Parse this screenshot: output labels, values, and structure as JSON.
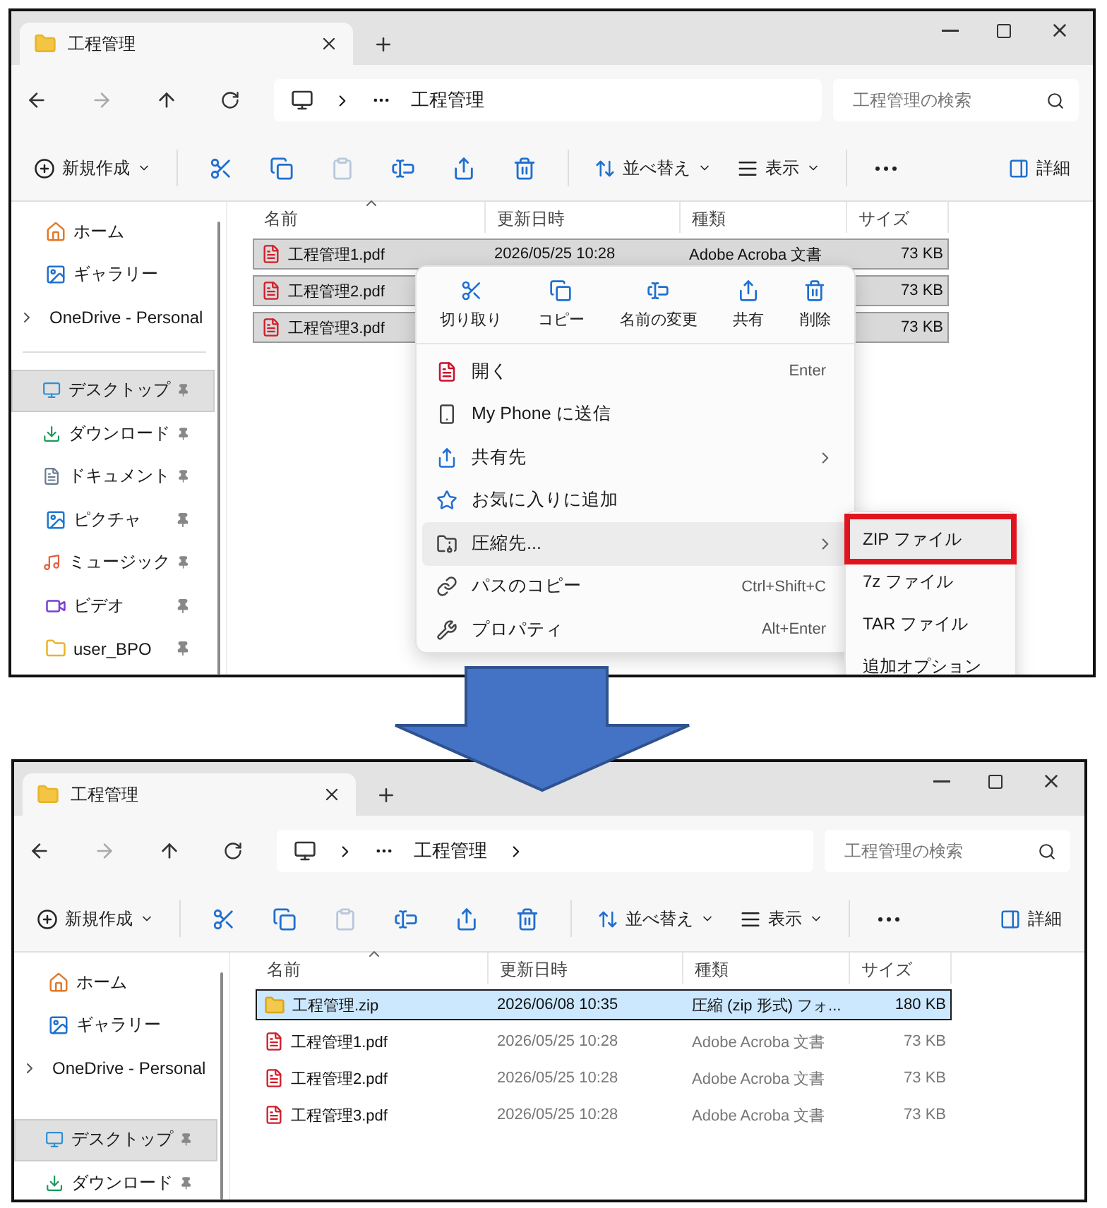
{
  "windows": [
    {
      "tab_title": "工程管理",
      "address": "工程管理",
      "address_chevron": false,
      "search_placeholder": "工程管理の検索",
      "toolbar": {
        "new": "新規作成",
        "icons": [
          {
            "kind": "cut",
            "disabled": false
          },
          {
            "kind": "copy",
            "disabled": false
          },
          {
            "kind": "paste",
            "disabled": true
          },
          {
            "kind": "rename",
            "disabled": false
          },
          {
            "kind": "share",
            "disabled": false
          },
          {
            "kind": "delete",
            "disabled": false
          }
        ],
        "sort": "並べ替え",
        "view": "表示",
        "details": "詳細"
      },
      "sidebar": [
        [
          {
            "kind": "home",
            "label": "ホーム",
            "pinned": false,
            "selected": false,
            "expandable": false
          },
          {
            "kind": "gallery",
            "label": "ギャラリー",
            "pinned": false,
            "selected": false,
            "expandable": false
          },
          {
            "kind": "file",
            "label": "OneDrive - Personal",
            "pinned": false,
            "selected": false,
            "expandable": true
          }
        ],
        [
          {
            "kind": "desktop",
            "label": "デスクトップ",
            "pinned": true,
            "selected": true,
            "expandable": false
          },
          {
            "kind": "download",
            "label": "ダウンロード",
            "pinned": true,
            "selected": false,
            "expandable": false
          },
          {
            "kind": "document",
            "label": "ドキュメント",
            "pinned": true,
            "selected": false,
            "expandable": false
          },
          {
            "kind": "picture",
            "label": "ピクチャ",
            "pinned": true,
            "selected": false,
            "expandable": false
          },
          {
            "kind": "music",
            "label": "ミュージック",
            "pinned": true,
            "selected": false,
            "expandable": false
          },
          {
            "kind": "video",
            "label": "ビデオ",
            "pinned": true,
            "selected": false,
            "expandable": false
          },
          {
            "kind": "folder",
            "label": "user_BPO",
            "pinned": true,
            "selected": false,
            "expandable": false
          }
        ]
      ],
      "list_focused": false,
      "columns": [
        "名前",
        "更新日時",
        "種類",
        "サイズ"
      ],
      "rows": [
        {
          "kind": "pdf",
          "name": "工程管理1.pdf",
          "date": "2026/05/25 10:28",
          "type": "Adobe Acroba 文書",
          "size": "73 KB",
          "selected": true
        },
        {
          "kind": "pdf",
          "name": "工程管理2.pdf",
          "size": "73 KB",
          "selected": true
        },
        {
          "kind": "pdf",
          "name": "工程管理3.pdf",
          "size": "73 KB",
          "selected": true
        }
      ],
      "context_menu": {
        "actions": [
          {
            "kind": "cut",
            "label": "切り取り"
          },
          {
            "kind": "copy",
            "label": "コピー"
          },
          {
            "kind": "rename",
            "label": "名前の変更"
          },
          {
            "kind": "share",
            "label": "共有"
          },
          {
            "kind": "delete",
            "label": "削除"
          }
        ],
        "items": [
          {
            "kind": "pdf",
            "label": "開く",
            "shortcut": "Enter",
            "submenu": false,
            "highlighted": false
          },
          {
            "kind": "phone",
            "label": "My Phone に送信",
            "submenu": false,
            "highlighted": false
          },
          {
            "kind": "share",
            "label": "共有先",
            "submenu": true,
            "highlighted": false
          },
          {
            "kind": "star",
            "label": "お気に入りに追加",
            "submenu": false,
            "highlighted": false
          },
          {
            "kind": "archive",
            "label": "圧縮先...",
            "submenu": true,
            "highlighted": true
          },
          {
            "kind": "path",
            "label": "パスのコピー",
            "shortcut": "Ctrl+Shift+C",
            "submenu": false,
            "highlighted": false
          },
          {
            "kind": "wrench",
            "label": "プロパティ",
            "shortcut": "Alt+Enter",
            "submenu": false,
            "highlighted": false
          }
        ],
        "submenu": [
          {
            "label": "ZIP ファイル",
            "highlighted": true,
            "emphasized": true
          },
          {
            "label": "7z ファイル",
            "highlighted": false,
            "emphasized": false
          },
          {
            "label": "TAR ファイル",
            "highlighted": false,
            "emphasized": false
          },
          {
            "label": "追加オプション",
            "highlighted": false,
            "emphasized": false
          }
        ]
      }
    },
    {
      "tab_title": "工程管理",
      "address": "工程管理",
      "address_chevron": true,
      "search_placeholder": "工程管理の検索",
      "toolbar": {
        "new": "新規作成",
        "icons": [
          {
            "kind": "cut",
            "disabled": false
          },
          {
            "kind": "copy",
            "disabled": false
          },
          {
            "kind": "paste",
            "disabled": true
          },
          {
            "kind": "rename",
            "disabled": false
          },
          {
            "kind": "share",
            "disabled": false
          },
          {
            "kind": "delete",
            "disabled": false
          }
        ],
        "sort": "並べ替え",
        "view": "表示",
        "details": "詳細"
      },
      "sidebar": [
        [
          {
            "kind": "home",
            "label": "ホーム",
            "pinned": false,
            "selected": false,
            "expandable": false
          },
          {
            "kind": "gallery",
            "label": "ギャラリー",
            "pinned": false,
            "selected": false,
            "expandable": false
          },
          {
            "kind": "file",
            "label": "OneDrive - Personal",
            "pinned": false,
            "selected": false,
            "expandable": true
          }
        ],
        [
          {
            "kind": "desktop",
            "label": "デスクトップ",
            "pinned": true,
            "selected": true,
            "expandable": false
          },
          {
            "kind": "download",
            "label": "ダウンロード",
            "pinned": true,
            "selected": false,
            "expandable": false
          }
        ]
      ],
      "list_focused": true,
      "columns": [
        "名前",
        "更新日時",
        "種類",
        "サイズ"
      ],
      "rows": [
        {
          "kind": "zip",
          "name": "工程管理.zip",
          "date": "2026/06/08 10:35",
          "type": "圧縮 (zip 形式) フォ...",
          "size": "180 KB",
          "selected": true
        },
        {
          "kind": "pdf",
          "name": "工程管理1.pdf",
          "date": "2026/05/25 10:28",
          "type": "Adobe Acroba 文書",
          "size": "73 KB",
          "selected": false
        },
        {
          "kind": "pdf",
          "name": "工程管理2.pdf",
          "date": "2026/05/25 10:28",
          "type": "Adobe Acroba 文書",
          "size": "73 KB",
          "selected": false
        },
        {
          "kind": "pdf",
          "name": "工程管理3.pdf",
          "date": "2026/05/25 10:28",
          "type": "Adobe Acroba 文書",
          "size": "73 KB",
          "selected": false
        }
      ]
    }
  ]
}
